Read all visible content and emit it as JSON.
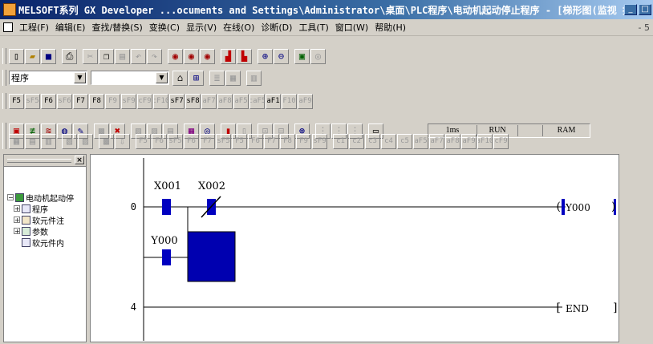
{
  "title": {
    "text": "MELSOFT系列 GX Developer ...ocuments and Settings\\Administrator\\桌面\\PLC程序\\电动机起动停止程序 - [梯形图(监视 执行中) ..."
  },
  "menu": [
    {
      "label": "工程(F)"
    },
    {
      "label": "编辑(E)"
    },
    {
      "label": "查找/替换(S)"
    },
    {
      "label": "变换(C)"
    },
    {
      "label": "显示(V)"
    },
    {
      "label": "在线(O)"
    },
    {
      "label": "诊断(D)"
    },
    {
      "label": "工具(T)"
    },
    {
      "label": "窗口(W)"
    },
    {
      "label": "帮助(H)"
    }
  ],
  "toolbar3": {
    "combo1": "程序",
    "combo2": ""
  },
  "toolbar4": {
    "keys": [
      "F5",
      "sF5",
      "F6",
      "sF6",
      "F7",
      "F8",
      "F9",
      "sF9",
      "cF9",
      "cF10",
      "sF7",
      "sF8",
      "aF7",
      "aF8",
      "aF5",
      "caF5",
      "caF10",
      "F10",
      "aF9"
    ]
  },
  "toolbar5": {
    "status": [
      "1ms",
      "RUN",
      "RAM"
    ]
  },
  "toolbar6": {
    "keys": [
      "F5",
      "F6",
      "sF5",
      "F6",
      "F7",
      "sF5",
      "F5",
      "F6",
      "F7",
      "F8",
      "F9",
      "sF9",
      "c1",
      "c2",
      "c3",
      "c4",
      "c5",
      "aF5",
      "aF7",
      "aF8",
      "aF9",
      "aF10",
      "cF9"
    ]
  },
  "tree": {
    "root": "电动机起动停",
    "items": [
      {
        "label": "程序"
      },
      {
        "label": "软元件注"
      },
      {
        "label": "参数"
      },
      {
        "label": "软元件内"
      }
    ]
  },
  "ladder": {
    "rungs": [
      {
        "step": "0"
      },
      {
        "step": "4"
      }
    ],
    "contacts": [
      {
        "label": "X001",
        "state": "on"
      },
      {
        "label": "X002",
        "state": "closed-NC"
      },
      {
        "label": "Y000",
        "state": "on"
      }
    ],
    "coil": "Y000",
    "end": "END"
  },
  "colors": {
    "title_start": "#0a246a",
    "active_fill": "#0000c0"
  }
}
